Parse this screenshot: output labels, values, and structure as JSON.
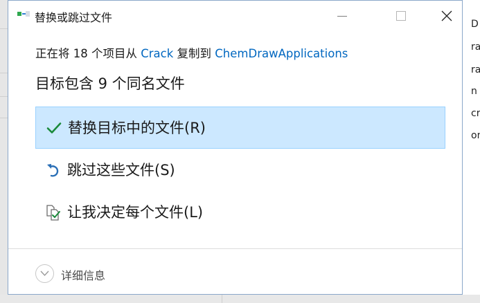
{
  "dialog": {
    "title": "替换或跳过文件",
    "info": {
      "prefix": "正在将 18 个项目从 ",
      "source": "Crack",
      "middle": " 复制到 ",
      "destination": "ChemDrawApplications"
    },
    "heading": "目标包含 9 个同名文件",
    "options": [
      {
        "label": "替换目标中的文件(R)",
        "icon": "checkmark-icon",
        "selected": true
      },
      {
        "label": "跳过这些文件(S)",
        "icon": "undo-arrow-icon",
        "selected": false
      },
      {
        "label": "让我决定每个文件(L)",
        "icon": "compare-files-icon",
        "selected": false
      }
    ],
    "details_label": "详细信息"
  },
  "background_window": {
    "right_fragments": [
      "D",
      "ra",
      "ra",
      "n",
      "cr",
      "on"
    ]
  },
  "colors": {
    "selected_bg": "#cce8ff",
    "selected_border": "#99d1ff",
    "link": "#0067c0",
    "check": "#1a8a3a"
  }
}
